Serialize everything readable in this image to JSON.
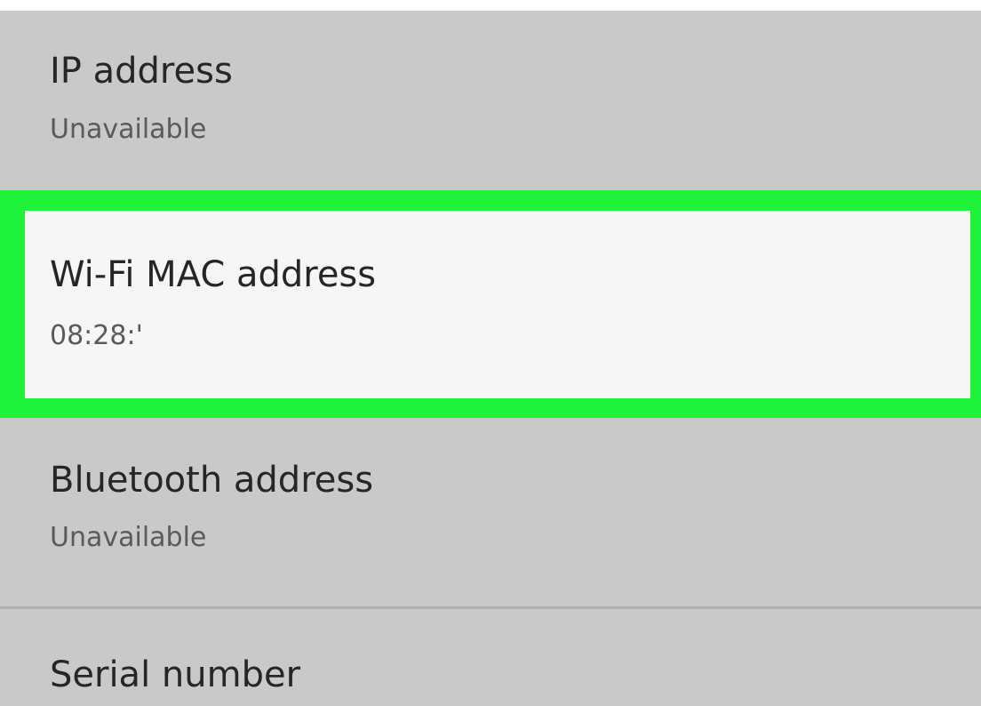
{
  "colors": {
    "background": "#c9c9c9",
    "highlight_border": "#1ff23a",
    "selected_row_background": "#f6f6f6",
    "title_text": "#262626",
    "subtitle_text": "#5a5a5a",
    "divider": "#b1b1b1"
  },
  "items": [
    {
      "id": "ip-address",
      "title": "IP address",
      "value": "Unavailable"
    },
    {
      "id": "wifi-mac-address",
      "title": "Wi-Fi MAC address",
      "value": "08:28:'",
      "highlighted": true
    },
    {
      "id": "bluetooth-address",
      "title": "Bluetooth address",
      "value": "Unavailable"
    },
    {
      "id": "serial-number",
      "title": "Serial number"
    }
  ]
}
